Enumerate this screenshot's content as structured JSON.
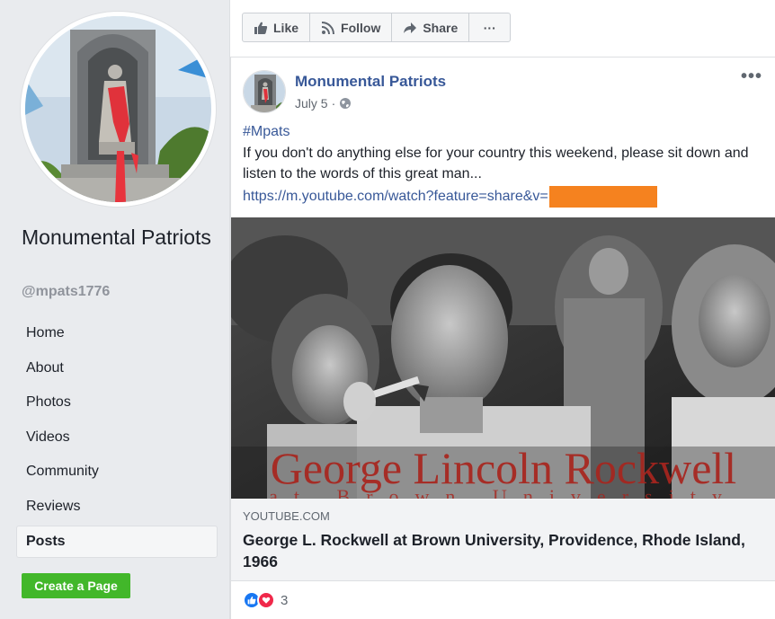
{
  "sidebar": {
    "page_name": "Monumental Patriots",
    "handle": "@mpats1776",
    "nav": [
      {
        "label": "Home"
      },
      {
        "label": "About"
      },
      {
        "label": "Photos"
      },
      {
        "label": "Videos"
      },
      {
        "label": "Community"
      },
      {
        "label": "Reviews"
      },
      {
        "label": "Posts",
        "active": true
      }
    ],
    "create_page_label": "Create a Page"
  },
  "actions": {
    "like": "Like",
    "follow": "Follow",
    "share": "Share",
    "more": "···"
  },
  "post": {
    "author": "Monumental Patriots",
    "date": "July 5",
    "dot": "·",
    "more": "•••",
    "hashtag": "#Mpats",
    "text": "If you don't do anything else for your country this weekend, please sit down and listen to the words of this great man...",
    "link_text": "https://m.youtube.com/watch?feature=share&v=",
    "preview_overlay": "George Lincoln Rockwell",
    "preview_subtitle": "at Brown University",
    "domain": "YOUTUBE.COM",
    "link_title": "George L. Rockwell at Brown University, Providence, Rhode Island, 1966",
    "reaction_count": "3"
  },
  "colors": {
    "link_blue": "#385898",
    "create_green": "#42b72a",
    "redaction_orange": "#f5821f",
    "like_blue": "#1877f2",
    "love_red": "#f0284a"
  },
  "icons": {
    "like": "thumbs-up-icon",
    "follow": "rss-icon",
    "share": "share-arrow-icon",
    "privacy": "globe-icon"
  }
}
